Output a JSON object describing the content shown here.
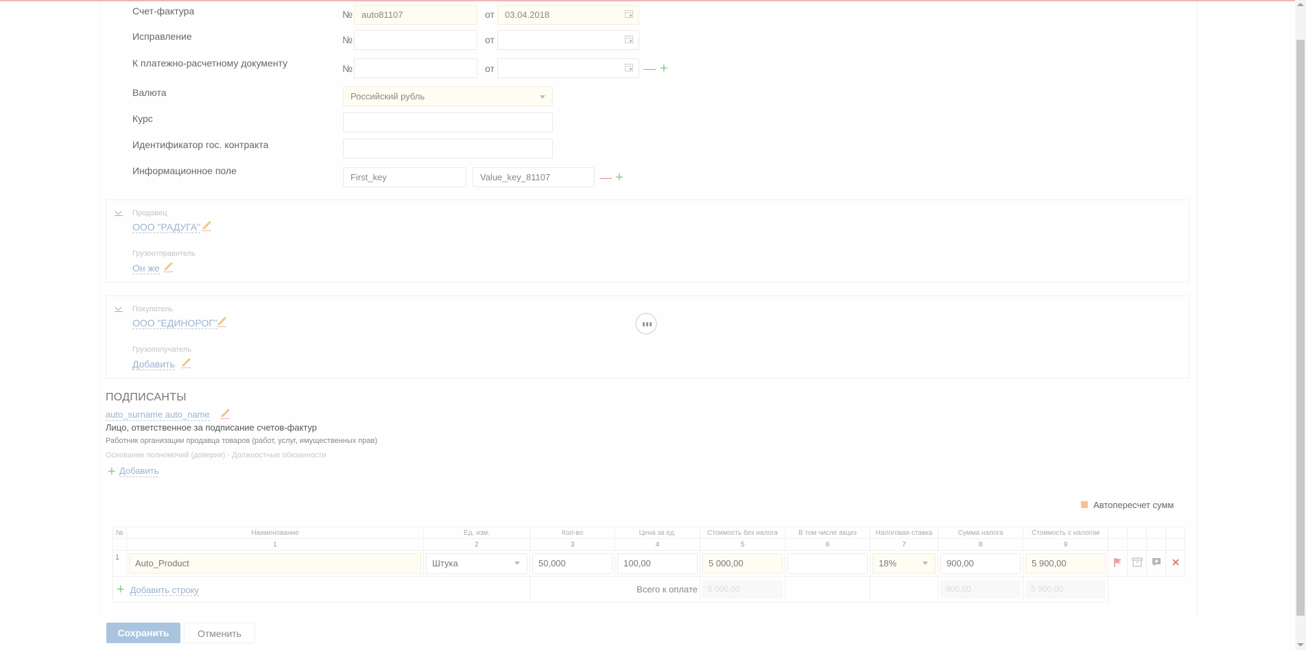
{
  "invoice": {
    "label": "Счет-фактура",
    "num_prefix": "№",
    "number": "auto81107",
    "date_prefix": "от",
    "date": "03.04.2018"
  },
  "correction": {
    "label": "Исправление",
    "num_prefix": "№",
    "date_prefix": "от"
  },
  "payment_doc": {
    "label": "К платежно-расчетному документу",
    "num_prefix": "№",
    "date_prefix": "от"
  },
  "currency": {
    "label": "Валюта",
    "value": "Российский рубль"
  },
  "rate": {
    "label": "Курс"
  },
  "contract_id": {
    "label": "Идентификатор гос. контракта"
  },
  "info_field": {
    "label": "Информационное поле",
    "key": "First_key",
    "value": "Value_key_81107"
  },
  "seller_panel": {
    "seller_label": "Продавец",
    "seller_name": "ООО \"РАДУГА\"",
    "shipper_label": "Грузоотправитель",
    "shipper_name": "Он же"
  },
  "buyer_panel": {
    "buyer_label": "Покупатель",
    "buyer_name": "ООО \"ЕДИНОРОГ\"",
    "consignee_label": "Грузополучатель",
    "consignee_action": "Добавить"
  },
  "signers": {
    "title": "ПОДПИСАНТЫ",
    "name": "auto_surname auto_name",
    "role": "Лицо, ответственное за подписание счетов-фактур",
    "desc": "Работник организации продавца товаров (работ, услуг, имущественных прав)",
    "basis": "Основание полномочий (доверия) - Должностные обязанности",
    "add": "Добавить"
  },
  "auto_recalc": "Автопересчет сумм",
  "table": {
    "headers": [
      "№",
      "Наименование",
      "Ед. изм.",
      "Кол-во",
      "Цена за ед.",
      "Стоимость без налога",
      "В том числе акциз",
      "Налоговая ставка",
      "Сумма налога",
      "Стоимость с налогом"
    ],
    "numbers": [
      "",
      "1",
      "2",
      "3",
      "4",
      "5",
      "6",
      "7",
      "8",
      "9"
    ],
    "row": {
      "index": "1",
      "name": "Auto_Product",
      "unit": "Штука",
      "qty": "50,000",
      "price": "100,00",
      "cost": "5 000,00",
      "excise": "",
      "rate": "18%",
      "tax": "900,00",
      "total": "5 900,00"
    },
    "add_row": "Добавить строку",
    "total_label": "Всего к оплате",
    "total_cost": "5 000,00",
    "total_tax": "900,00",
    "total_sum": "5 900,00"
  },
  "buttons": {
    "save": "Сохранить",
    "cancel": "Отменить"
  },
  "colors": {
    "accent_primary": "#a9c4de",
    "required_bg": "#fffdf2",
    "link": "#9ab3cf",
    "checkbox": "#f7c48e"
  }
}
